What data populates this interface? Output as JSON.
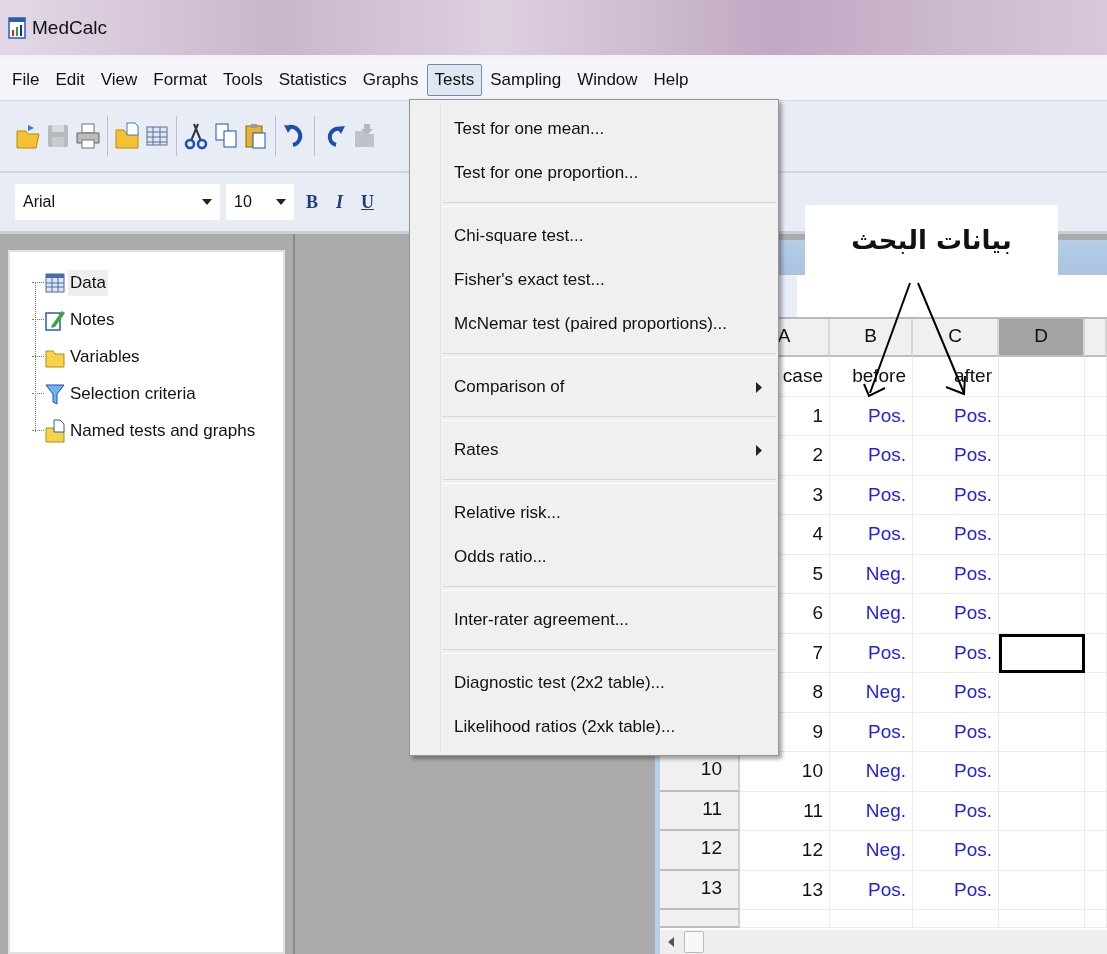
{
  "window": {
    "title": "MedCalc"
  },
  "menu_bar": [
    {
      "label": "File",
      "selected": false
    },
    {
      "label": "Edit",
      "selected": false
    },
    {
      "label": "View",
      "selected": false
    },
    {
      "label": "Format",
      "selected": false
    },
    {
      "label": "Tools",
      "selected": false
    },
    {
      "label": "Statistics",
      "selected": false
    },
    {
      "label": "Graphs",
      "selected": false
    },
    {
      "label": "Tests",
      "selected": true
    },
    {
      "label": "Sampling",
      "selected": false
    },
    {
      "label": "Window",
      "selected": false
    },
    {
      "label": "Help",
      "selected": false
    }
  ],
  "toolbar": [
    [
      {
        "kind": "open",
        "disabled": false
      },
      {
        "kind": "save",
        "disabled": true
      },
      {
        "kind": "print",
        "disabled": false
      }
    ],
    [
      {
        "kind": "folder",
        "disabled": false
      },
      {
        "kind": "grid",
        "disabled": false
      }
    ],
    [
      {
        "kind": "cut",
        "disabled": false
      },
      {
        "kind": "copy",
        "disabled": false
      },
      {
        "kind": "paste",
        "disabled": false
      }
    ],
    [
      {
        "kind": "undo",
        "disabled": false
      }
    ],
    [
      {
        "kind": "redo",
        "disabled": false
      },
      {
        "kind": "import",
        "disabled": true
      }
    ]
  ],
  "format_bar": {
    "font": "Arial",
    "size": "10",
    "buttons": [
      {
        "label": "B",
        "kind": "bold"
      },
      {
        "label": "I",
        "kind": "italic"
      },
      {
        "label": "U",
        "kind": "underline"
      }
    ]
  },
  "tree": [
    {
      "label": "Data",
      "kind": "table",
      "selected": true
    },
    {
      "label": "Notes",
      "kind": "notes",
      "selected": false
    },
    {
      "label": "Variables",
      "kind": "folder",
      "selected": false
    },
    {
      "label": "Selection criteria",
      "kind": "filter",
      "selected": false
    },
    {
      "label": "Named tests and graphs",
      "kind": "named",
      "selected": false
    }
  ],
  "tests_menu": [
    [
      {
        "label": "Test for one mean...",
        "submenu": false
      },
      {
        "label": "Test for one proportion...",
        "submenu": false
      }
    ],
    [
      {
        "label": "Chi-square test...",
        "submenu": false
      },
      {
        "label": "Fisher's exact test...",
        "submenu": false
      },
      {
        "label": "McNemar test (paired proportions)...",
        "submenu": false
      }
    ],
    [
      {
        "label": "Comparison of",
        "submenu": true
      }
    ],
    [
      {
        "label": "Rates",
        "submenu": true
      }
    ],
    [
      {
        "label": "Relative risk...",
        "submenu": false
      },
      {
        "label": "Odds ratio...",
        "submenu": false
      }
    ],
    [
      {
        "label": "Inter-rater agreement...",
        "submenu": false
      }
    ],
    [
      {
        "label": "Diagnostic test (2x2 table)...",
        "submenu": false
      },
      {
        "label": "Likelihood ratios (2xk table)...",
        "submenu": false
      }
    ]
  ],
  "spreadsheet": {
    "columns": [
      {
        "label": "A",
        "selected": false
      },
      {
        "label": "B",
        "selected": false
      },
      {
        "label": "C",
        "selected": false
      },
      {
        "label": "D",
        "selected": true
      }
    ],
    "header_row": [
      "case",
      "before",
      "after"
    ],
    "rows": [
      {
        "cells": [
          "1",
          "Pos.",
          "Pos."
        ],
        "d_selected": false
      },
      {
        "cells": [
          "2",
          "Pos.",
          "Pos."
        ],
        "d_selected": false
      },
      {
        "cells": [
          "3",
          "Pos.",
          "Pos."
        ],
        "d_selected": false
      },
      {
        "cells": [
          "4",
          "Pos.",
          "Pos."
        ],
        "d_selected": false
      },
      {
        "cells": [
          "5",
          "Neg.",
          "Pos."
        ],
        "d_selected": false
      },
      {
        "cells": [
          "6",
          "Neg.",
          "Pos."
        ],
        "d_selected": false
      },
      {
        "cells": [
          "7",
          "Pos.",
          "Pos."
        ],
        "d_selected": true
      },
      {
        "cells": [
          "8",
          "Neg.",
          "Pos."
        ],
        "d_selected": false
      },
      {
        "cells": [
          "9",
          "Pos.",
          "Pos."
        ],
        "d_selected": false
      },
      {
        "row_number": "10",
        "cells": [
          "10",
          "Neg.",
          "Pos."
        ],
        "d_selected": false
      },
      {
        "row_number": "11",
        "cells": [
          "11",
          "Neg.",
          "Pos."
        ],
        "d_selected": false
      },
      {
        "row_number": "12",
        "cells": [
          "12",
          "Neg.",
          "Pos."
        ],
        "d_selected": false
      },
      {
        "row_number": "13",
        "cells": [
          "13",
          "Pos.",
          "Pos."
        ],
        "d_selected": false
      }
    ]
  },
  "annotation": {
    "text": "بيانات البحث"
  }
}
